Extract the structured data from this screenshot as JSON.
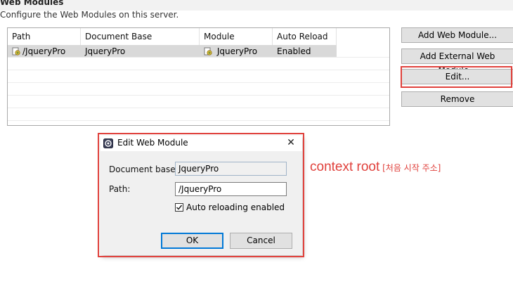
{
  "section": {
    "title": "Web Modules",
    "description": "Configure the Web Modules on this server."
  },
  "table": {
    "columns": [
      "Path",
      "Document Base",
      "Module",
      "Auto Reload"
    ],
    "rows": [
      {
        "path": "/JqueryPro",
        "document_base": "JqueryPro",
        "module": "JqueryPro",
        "auto_reload": "Enabled"
      }
    ]
  },
  "buttons": {
    "add_web_module": "Add Web Module...",
    "add_external_web_module": "Add External Web Module...",
    "edit": "Edit...",
    "remove": "Remove"
  },
  "dialog": {
    "title": "Edit Web Module",
    "document_base_label": "Document base:",
    "document_base_value": "JqueryPro",
    "path_label": "Path:",
    "path_value": "/JqueryPro",
    "auto_reload_label": "Auto reloading enabled",
    "ok_label": "OK",
    "cancel_label": "Cancel"
  },
  "annotation": {
    "main": "context root",
    "sub": "[처음 시작 주소]"
  },
  "colors": {
    "highlight": "#e0413c",
    "selection": "#d9d9d9"
  }
}
